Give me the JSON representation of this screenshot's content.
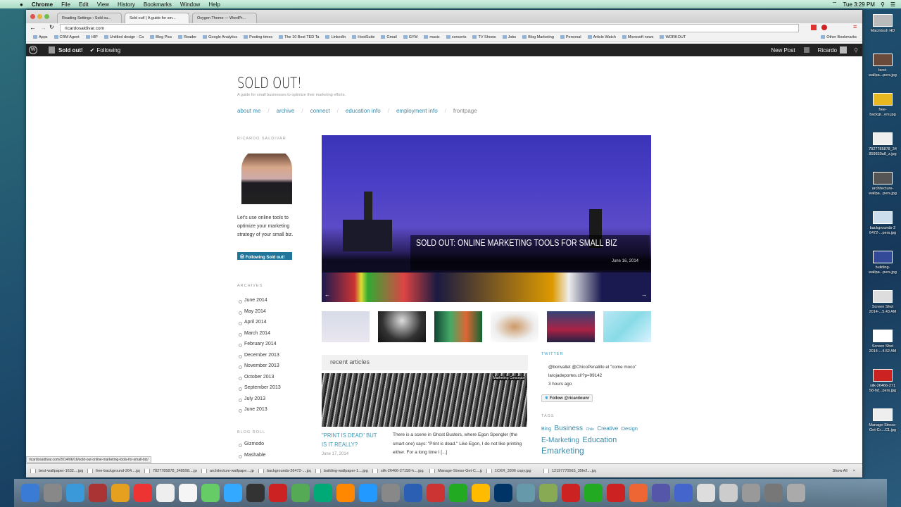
{
  "menubar": {
    "app": "Chrome",
    "items": [
      "File",
      "Edit",
      "View",
      "History",
      "Bookmarks",
      "Window",
      "Help"
    ],
    "clock": "Tue 3:29 PM"
  },
  "tabs": [
    {
      "title": "Reading Settings ‹ Sold ou..."
    },
    {
      "title": "Sold out! | A guide for sm..."
    },
    {
      "title": "Oxygen Theme — WordPr..."
    }
  ],
  "url": "ricardosaldivar.com",
  "bookmarks": [
    "Apps",
    "CRM Agent",
    "HIP",
    "Untitled design - Ca",
    "Blog Pics",
    "Reader",
    "Google Analytics",
    "Posting times",
    "The 10 Best TED Ta",
    "LinkedIn",
    "HootSuite",
    "Gmail",
    "GYM",
    "music",
    "concerts",
    "TV Shows",
    "Jobs",
    "Blog Marketing",
    "Personal",
    "Article Watch",
    "Microsoft news",
    "WORKOUT",
    "Other Bookmarks"
  ],
  "adminbar": {
    "site": "Sold out!",
    "following": "Following",
    "new_post": "New Post",
    "user": "Ricardo"
  },
  "site": {
    "title": "SOLD OUT!",
    "tagline": "A guide for small businesses to optimize their marketing efforts.",
    "nav": [
      "about me",
      "archive",
      "connect",
      "education info",
      "employment info",
      "frontpage"
    ]
  },
  "sidebar": {
    "author_title": "RICARDO SALDIVAR",
    "bio": "Let's use online tools to optimize your marketing strategy of your small biz.",
    "follow_button": "Following Sold out!",
    "archives_title": "ARCHIVES",
    "archives": [
      "June 2014",
      "May 2014",
      "April 2014",
      "March 2014",
      "February 2014",
      "December 2013",
      "November 2013",
      "October 2013",
      "September 2013",
      "July 2013",
      "June 2013"
    ],
    "blogroll_title": "BLOG ROLL",
    "blogroll": [
      "Gizmodo",
      "Mashable"
    ]
  },
  "hero": {
    "title": "SOLD OUT: ONLINE MARKETING TOOLS FOR SMALL BIZ",
    "date": "June 16, 2014",
    "prev": "←",
    "next": "→"
  },
  "recent": {
    "heading": "recent articles",
    "article": {
      "title": "\"PRINT IS DEAD\" BUT IS IT REALLY?",
      "date": "June 17, 2014",
      "excerpt": "There is a scene in Ghost Busters, where Egon Spengler (the smart one) says: \"Print is dead.\" Like Egon, I do not like printing either. For a long time I [...]",
      "image_label": "Marketing Concepts"
    }
  },
  "twitter": {
    "title": "TWITTER",
    "tweet": "@bonvallet @ChicoPenalillo el \"come moco\" larojadeportes.cl/?p=99142",
    "time": "3 hours ago",
    "follow": "Follow @ricardounr"
  },
  "tags": {
    "title": "TAGS",
    "items": [
      "Bing",
      "Business",
      "Chile",
      "Creative",
      "Design",
      "E-Marketing",
      "Education",
      "Emarketing"
    ]
  },
  "status_url": "ricardosaldivar.com/2014/06/16/sold-out-online-marketing-tools-for-small-biz/",
  "downloads": [
    "best-wallpaper-1632....jpg",
    "free-background-264....jpg",
    "7827785878_348598....jpg",
    "architecture-wallpape....jpg",
    "backgrounds-26472-....jpg",
    "building-wallpaper-1....jpg",
    "silk-26466-27158-h....jpg",
    "Manage-Stress-Get-C....jpg",
    "1CKR_3306 copy.jpg",
    "12197770565_35fe2....jpg"
  ],
  "show_all": "Show All",
  "desktop": [
    "Macintosh HD",
    "best-wallpa...pers.jpg",
    "free-backgr...ers.jpg",
    "7827785878_34 859830a8_z.jpg",
    "architecture-wallpa...pers.jpg",
    "backgrounds-2 6472-...pers.jpg",
    "building-wallpa...pers.jpg",
    "Screen Shot 2014-...5.43 AM",
    "Screen Shot 2014-...4.52 AM",
    "silk-26466-271 58-hd...pers.jpg",
    "Manage-Stress-Get-Cr....C1.jpg"
  ]
}
